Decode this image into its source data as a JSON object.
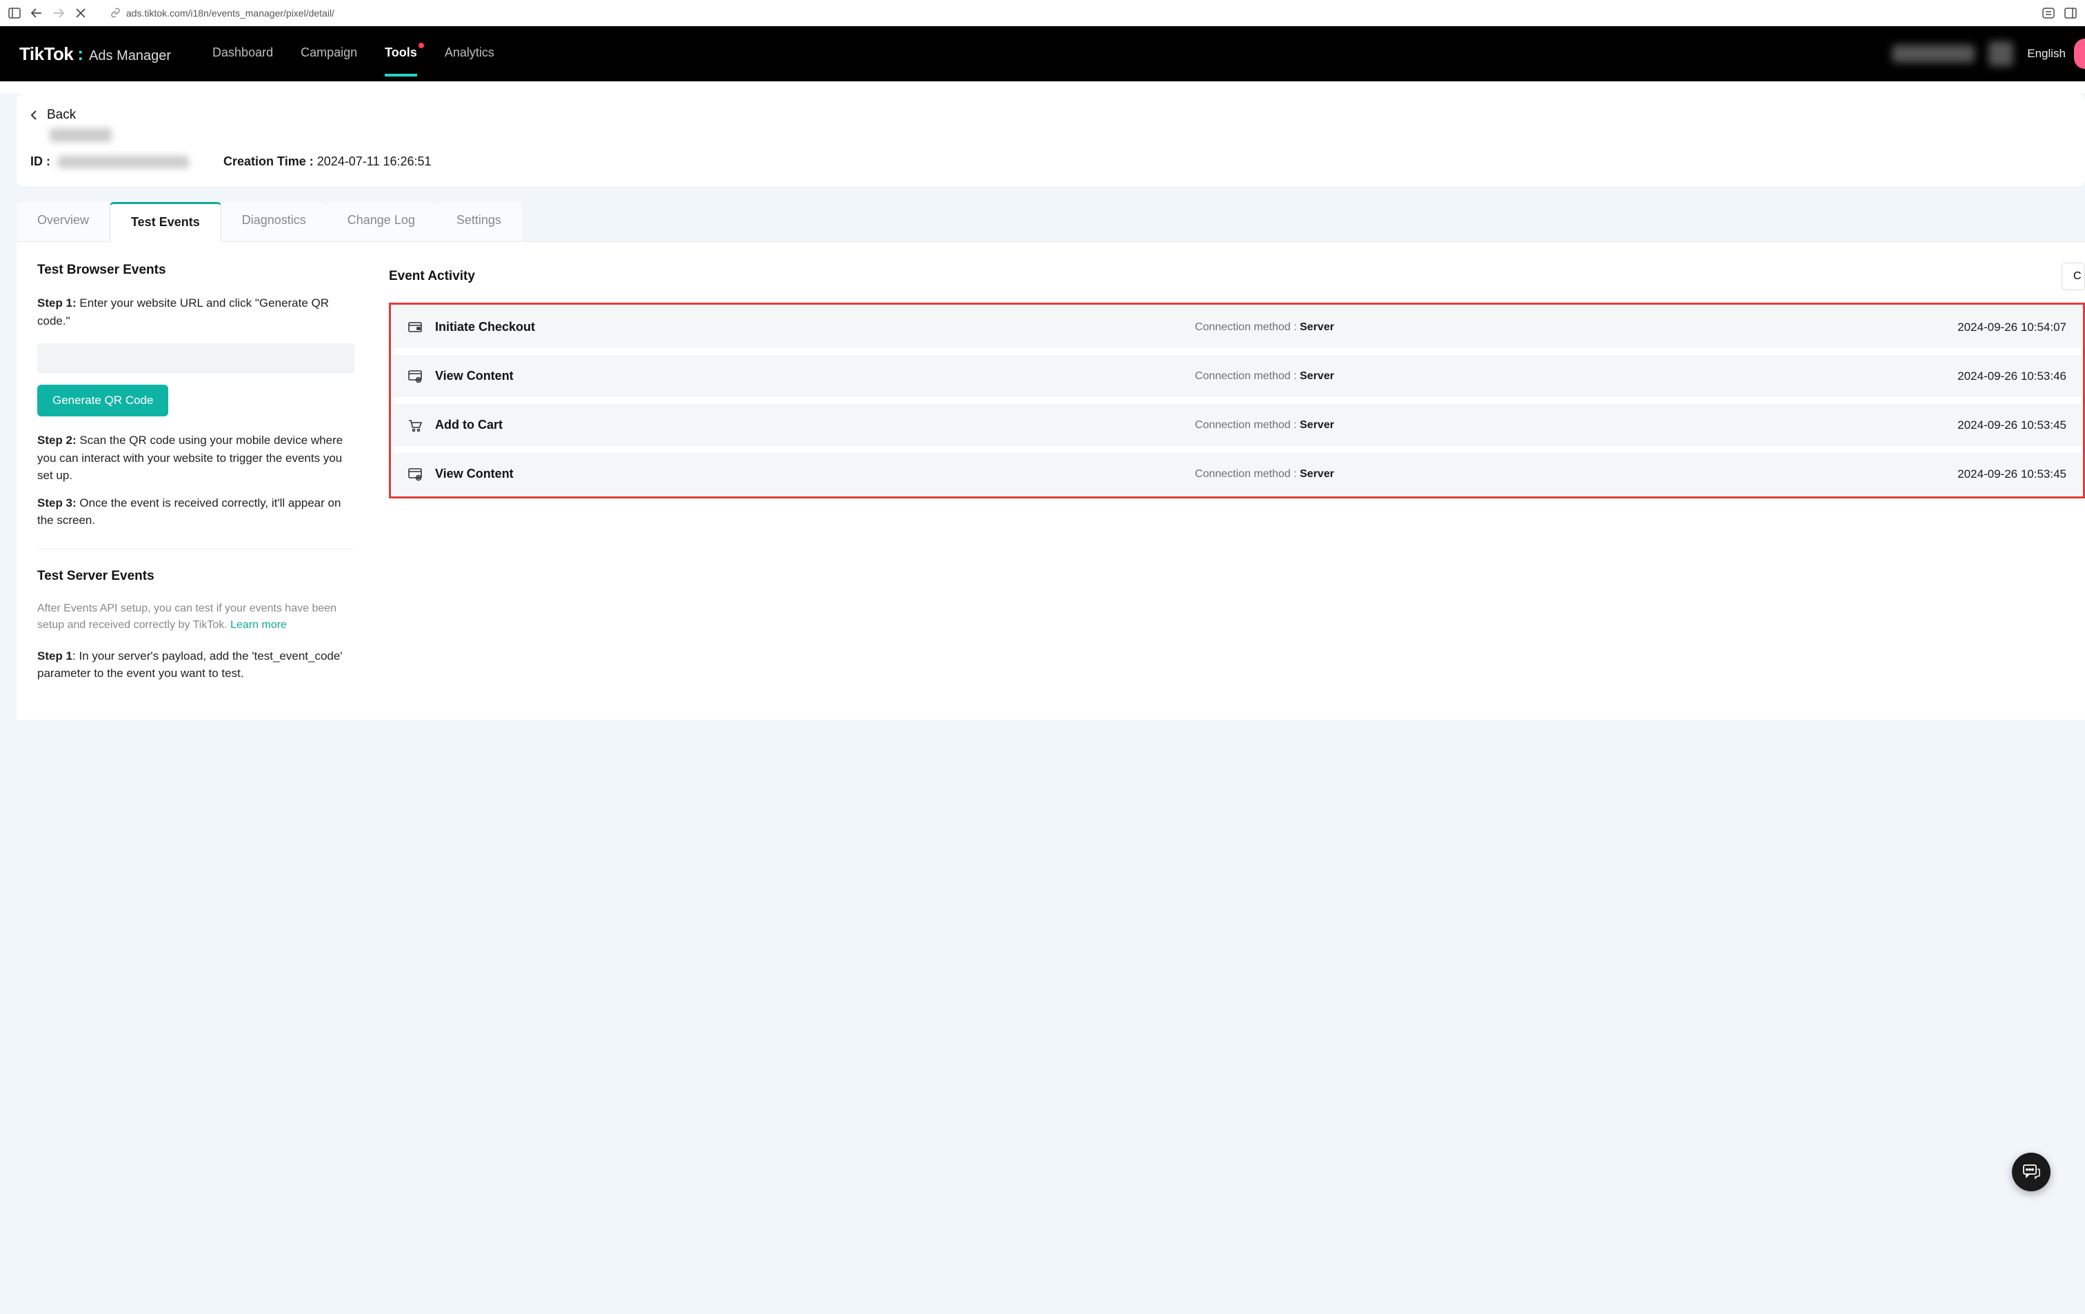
{
  "browser": {
    "url": "ads.tiktok.com/i18n/events_manager/pixel/detail/"
  },
  "header": {
    "logo_main": "TikTok",
    "logo_sub": "Ads Manager",
    "nav": [
      "Dashboard",
      "Campaign",
      "Tools",
      "Analytics"
    ],
    "nav_active_index": 2,
    "language": "English"
  },
  "page_header": {
    "back_label": "Back",
    "id_label": "ID :",
    "creation_label": "Creation Time :",
    "creation_value": "2024-07-11 16:26:51"
  },
  "tabs": {
    "items": [
      "Overview",
      "Test Events",
      "Diagnostics",
      "Change Log",
      "Settings"
    ],
    "active_index": 1
  },
  "left": {
    "browser_events_title": "Test Browser Events",
    "step1_label": "Step 1:",
    "step1_text": "Enter your website URL and click \"Generate QR code.\"",
    "url_placeholder": "",
    "generate_btn": "Generate QR Code",
    "step2_label": "Step 2:",
    "step2_text": "Scan the QR code using your mobile device where you can interact with your website to trigger the events you set up.",
    "step3_label": "Step 3:",
    "step3_text": "Once the event is received correctly, it'll appear on the screen.",
    "server_events_title": "Test Server Events",
    "server_events_desc": "After Events API setup, you can test if your events have been setup and received correctly by TikTok. ",
    "learn_more": "Learn more",
    "server_step1_label": "Step 1",
    "server_step1_text": ": In your server's payload, add the 'test_event_code' parameter to the event you want to test."
  },
  "right": {
    "title": "Event Activity",
    "clear_btn": "C",
    "connection_label": "Connection method : ",
    "events": [
      {
        "icon": "checkout",
        "name": "Initiate Checkout",
        "method": "Server",
        "time": "2024-09-26 10:54:07"
      },
      {
        "icon": "view",
        "name": "View Content",
        "method": "Server",
        "time": "2024-09-26 10:53:46"
      },
      {
        "icon": "cart",
        "name": "Add to Cart",
        "method": "Server",
        "time": "2024-09-26 10:53:45"
      },
      {
        "icon": "view",
        "name": "View Content",
        "method": "Server",
        "time": "2024-09-26 10:53:45"
      }
    ]
  }
}
